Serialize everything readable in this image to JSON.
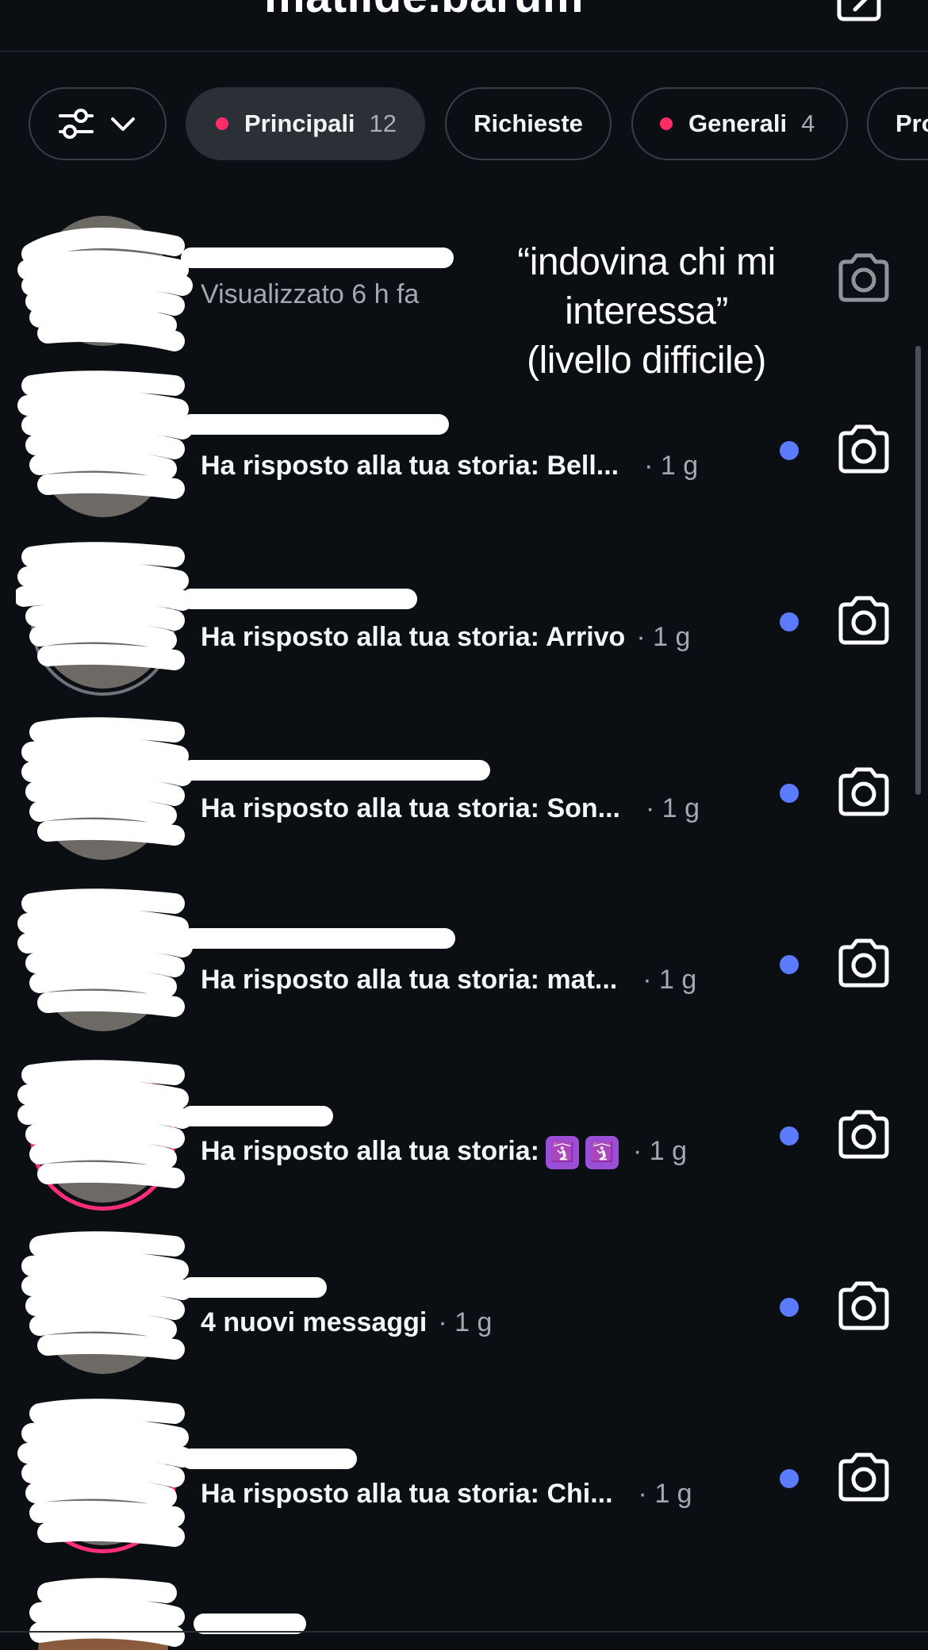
{
  "header": {
    "title": "matilde.barum"
  },
  "filters": {
    "settings_icon": "sliders-icon",
    "chips": [
      {
        "label": "Principali",
        "count": "12"
      },
      {
        "label": "Richieste"
      },
      {
        "label": "Generali",
        "count": "4"
      },
      {
        "label": "Pro"
      }
    ]
  },
  "caption": {
    "line1": "“indovina chi mi",
    "line2": "interessa”",
    "line3": "(livello difficile)"
  },
  "conversations": [
    {
      "message": "Visualizzato 6 h fa",
      "time": "",
      "unread": false
    },
    {
      "message": "Ha risposto alla tua storia: Bell...",
      "time": "· 1 g",
      "unread": true
    },
    {
      "message": "Ha risposto alla tua storia: Arrivo",
      "time": "· 1 g",
      "unread": true
    },
    {
      "message": "Ha risposto alla tua storia: Son...",
      "time": "· 1 g",
      "unread": true
    },
    {
      "message": "Ha risposto alla tua storia: mat...",
      "time": "· 1 g",
      "unread": true
    },
    {
      "message": "Ha risposto alla tua storia:",
      "time": "· 1 g",
      "unread": true,
      "emoji": [
        "🛐",
        "🛐"
      ]
    },
    {
      "message": "4 nuovi messaggi",
      "time": "· 1 g",
      "unread": true
    },
    {
      "message": "Ha risposto alla tua storia: Chi...",
      "time": "· 1 g",
      "unread": true
    }
  ],
  "colors": {
    "background": "#0b0e13",
    "unread_dot": "#5b7cff",
    "chip_dot": "#ff2d66"
  }
}
